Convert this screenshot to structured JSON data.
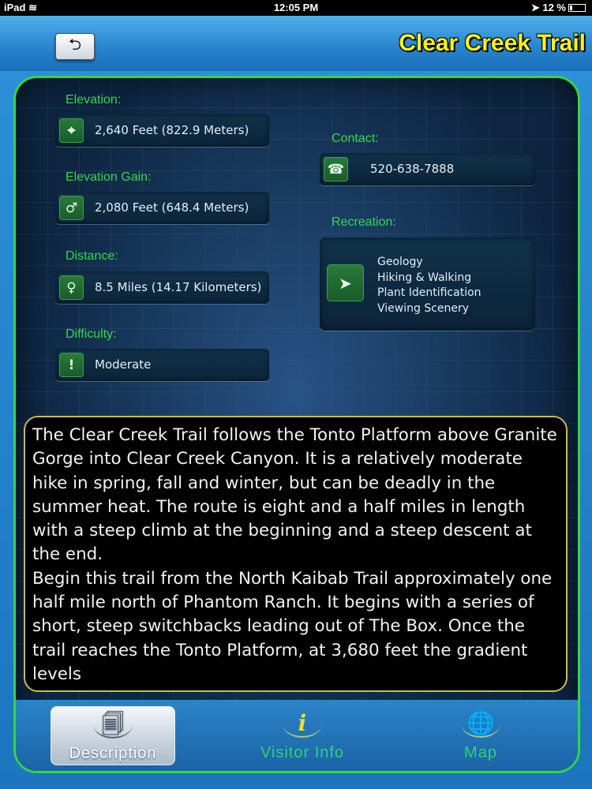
{
  "status_bar": {
    "device": "iPad",
    "wifi_icon": "wifi-icon",
    "time": "12:05 PM",
    "battery_text": "12 %"
  },
  "header": {
    "back_icon": "back-arrow-icon",
    "title": "Clear Creek Trail"
  },
  "details": {
    "elevation": {
      "label": "Elevation:",
      "value": "2,640 Feet (822.9 Meters)",
      "icon": "crosshair-icon"
    },
    "elevation_gain": {
      "label": "Elevation  Gain:",
      "value": "2,080 Feet (648.4 Meters)",
      "icon": "male-symbol-icon"
    },
    "distance": {
      "label": "Distance:",
      "value": "8.5 Miles (14.17 Kilometers)",
      "icon": "female-symbol-icon"
    },
    "difficulty": {
      "label": "Difficulty:",
      "value": "Moderate",
      "icon": "exclamation-icon"
    },
    "contact": {
      "label": "Contact:",
      "value": "520-638-7888",
      "icon": "phone-icon"
    },
    "recreation": {
      "label": "Recreation:",
      "icon": "cursor-arrow-icon",
      "items": [
        "Geology",
        "Hiking & Walking",
        "Plant Identification",
        "Viewing Scenery"
      ]
    }
  },
  "description": {
    "paragraphs": [
      "The Clear Creek Trail follows the Tonto Platform above Granite Gorge into Clear Creek Canyon. It is a relatively moderate hike in spring, fall and winter, but can be deadly in the summer heat. The route is eight and a half miles in length with a steep climb at the beginning and a steep descent at the end.",
      "Begin this trail from the North Kaibab Trail approximately one half mile north of Phantom Ranch. It begins with a series of short, steep switchbacks leading out of The Box. Once the trail reaches the Tonto Platform, at 3,680 feet the gradient levels"
    ]
  },
  "tabs": [
    {
      "label": "Description",
      "icon": "document-icon",
      "active": true
    },
    {
      "label": "Visitor Info",
      "icon": "info-icon",
      "active": false
    },
    {
      "label": "Map",
      "icon": "globe-search-icon",
      "active": false
    }
  ],
  "colors": {
    "title_yellow": "#f7ef22",
    "label_green": "#32d84a",
    "panel_border": "#2fd93f",
    "header_blue": "#2a86cf"
  }
}
